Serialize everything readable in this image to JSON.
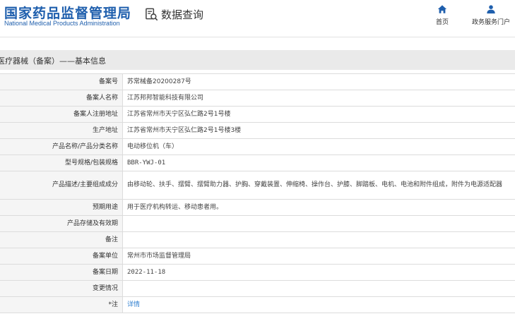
{
  "header": {
    "logo_cn": "国家药品监督管理局",
    "logo_en": "National Medical Products Administration",
    "query_title": "数据查询",
    "query_icon": "search-document-icon",
    "nav": [
      {
        "label": "首页",
        "icon": "home-icon"
      },
      {
        "label": "政务服务门户",
        "icon": "user-icon"
      }
    ]
  },
  "section": {
    "title": "医疗器械（备案）——基本信息"
  },
  "colors": {
    "brand": "#1f5fad",
    "link": "#2f7fd0",
    "section_bg": "#eaeaea",
    "label_bg": "#f5f5f5",
    "border": "#dcdcdc"
  },
  "rows": [
    {
      "label": "备案号",
      "value": "苏常械备20200287号"
    },
    {
      "label": "备案人名称",
      "value": "江苏邦邦智能科技有限公司"
    },
    {
      "label": "备案人注册地址",
      "value": "江苏省常州市天宁区弘仁路2号1号楼"
    },
    {
      "label": "生产地址",
      "value": "江苏省常州市天宁区弘仁路2号1号楼3楼"
    },
    {
      "label": "产品名称/产品分类名称",
      "value": "电动移位机（车）"
    },
    {
      "label": "型号规格/包装规格",
      "value": "BBR-YWJ-01"
    },
    {
      "label": "产品描述/主要组成成分",
      "value": "由移动轮、扶手、摆臂、摆臂助力器、护胸、穿戴装置、伸缩椅、操作台、护膝、脚踏板、电机、电池和附件组成，附件为电源适配器"
    },
    {
      "label": "预期用途",
      "value": "用于医疗机构转运、移动患者用。"
    },
    {
      "label": "产品存储及有效期",
      "value": ""
    },
    {
      "label": "备注",
      "value": ""
    },
    {
      "label": "备案单位",
      "value": "常州市市场监督管理局"
    },
    {
      "label": "备案日期",
      "value": "2022-11-18"
    },
    {
      "label": "变更情况",
      "value": ""
    },
    {
      "label": "*注",
      "value": "详情"
    }
  ]
}
